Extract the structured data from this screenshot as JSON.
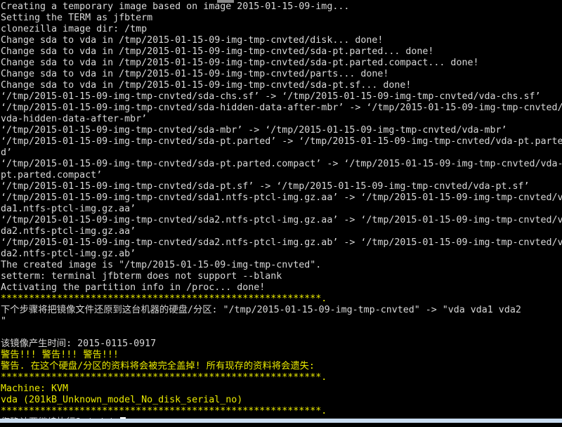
{
  "terminal": {
    "title": "clonezilla-restore-confirm",
    "cursor_symbol": "block-cursor",
    "colors": {
      "background": "#000000",
      "foreground": "#d0d0d0",
      "warning": "#eaea00",
      "bottom_strip": "#c9dcf0",
      "top_artifact": "#8a8a8a"
    },
    "lines": [
      {
        "text": "Creating a temporary image based on image 2015-01-15-09-img...",
        "color": "white"
      },
      {
        "text": "Setting the TERM as jfbterm",
        "color": "white"
      },
      {
        "text": "clonezilla image dir: /tmp",
        "color": "white"
      },
      {
        "text": "Change sda to vda in /tmp/2015-01-15-09-img-tmp-cnvted/disk... done!",
        "color": "white"
      },
      {
        "text": "Change sda to vda in /tmp/2015-01-15-09-img-tmp-cnvted/sda-pt.parted... done!",
        "color": "white"
      },
      {
        "text": "Change sda to vda in /tmp/2015-01-15-09-img-tmp-cnvted/sda-pt.parted.compact... done!",
        "color": "white"
      },
      {
        "text": "Change sda to vda in /tmp/2015-01-15-09-img-tmp-cnvted/parts... done!",
        "color": "white"
      },
      {
        "text": "Change sda to vda in /tmp/2015-01-15-09-img-tmp-cnvted/sda-pt.sf... done!",
        "color": "white"
      },
      {
        "text": "‘/tmp/2015-01-15-09-img-tmp-cnvted/sda-chs.sf’ -> ‘/tmp/2015-01-15-09-img-tmp-cnvted/vda-chs.sf’",
        "color": "white"
      },
      {
        "text": "‘/tmp/2015-01-15-09-img-tmp-cnvted/sda-hidden-data-after-mbr’ -> ‘/tmp/2015-01-15-09-img-tmp-cnvted/",
        "color": "white"
      },
      {
        "text": "vda-hidden-data-after-mbr’",
        "color": "white"
      },
      {
        "text": "‘/tmp/2015-01-15-09-img-tmp-cnvted/sda-mbr’ -> ‘/tmp/2015-01-15-09-img-tmp-cnvted/vda-mbr’",
        "color": "white"
      },
      {
        "text": "‘/tmp/2015-01-15-09-img-tmp-cnvted/sda-pt.parted’ -> ‘/tmp/2015-01-15-09-img-tmp-cnvted/vda-pt.parte",
        "color": "white"
      },
      {
        "text": "d’",
        "color": "white"
      },
      {
        "text": "‘/tmp/2015-01-15-09-img-tmp-cnvted/sda-pt.parted.compact’ -> ‘/tmp/2015-01-15-09-img-tmp-cnvted/vda-",
        "color": "white"
      },
      {
        "text": "pt.parted.compact’",
        "color": "white"
      },
      {
        "text": "‘/tmp/2015-01-15-09-img-tmp-cnvted/sda-pt.sf’ -> ‘/tmp/2015-01-15-09-img-tmp-cnvted/vda-pt.sf’",
        "color": "white"
      },
      {
        "text": "‘/tmp/2015-01-15-09-img-tmp-cnvted/sda1.ntfs-ptcl-img.gz.aa’ -> ‘/tmp/2015-01-15-09-img-tmp-cnvted/v",
        "color": "white"
      },
      {
        "text": "da1.ntfs-ptcl-img.gz.aa’",
        "color": "white"
      },
      {
        "text": "‘/tmp/2015-01-15-09-img-tmp-cnvted/sda2.ntfs-ptcl-img.gz.aa’ -> ‘/tmp/2015-01-15-09-img-tmp-cnvted/v",
        "color": "white"
      },
      {
        "text": "da2.ntfs-ptcl-img.gz.aa’",
        "color": "white"
      },
      {
        "text": "‘/tmp/2015-01-15-09-img-tmp-cnvted/sda2.ntfs-ptcl-img.gz.ab’ -> ‘/tmp/2015-01-15-09-img-tmp-cnvted/v",
        "color": "white"
      },
      {
        "text": "da2.ntfs-ptcl-img.gz.ab’",
        "color": "white"
      },
      {
        "text": "The created image is \"/tmp/2015-01-15-09-img-tmp-cnvted\".",
        "color": "white"
      },
      {
        "text": "setterm: terminal jfbterm does not support --blank",
        "color": "white"
      },
      {
        "text": "Activating the partition info in /proc... done!",
        "color": "white"
      },
      {
        "text": "*********************************************************.",
        "color": "yellow"
      },
      {
        "text": "下个步骤将把镜像文件还原到这台机器的硬盘/分区: \"/tmp/2015-01-15-09-img-tmp-cnvted\" -> \"vda vda1 vda2",
        "color": "white"
      },
      {
        "text": "\"",
        "color": "white"
      },
      {
        "text": "",
        "color": "white"
      },
      {
        "text": "该镜像产生时间: 2015-0115-0917",
        "color": "white"
      },
      {
        "text": "警告!!! 警告!!! 警告!!!",
        "color": "yellow"
      },
      {
        "text": "警告. 在这个硬盘/分区的资料将会被完全盖掉! 所有现存的资料将会遗失:",
        "color": "yellow"
      },
      {
        "text": "*********************************************************.",
        "color": "yellow"
      },
      {
        "text": "Machine: KVM",
        "color": "yellow"
      },
      {
        "text": "vda (201kB_Unknown_model_No_disk_serial_no)",
        "color": "yellow"
      },
      {
        "text": "*********************************************************.",
        "color": "yellow"
      },
      {
        "text": "您确认要继续执行? (y/n)",
        "color": "ltgray",
        "cursor": true
      }
    ]
  }
}
